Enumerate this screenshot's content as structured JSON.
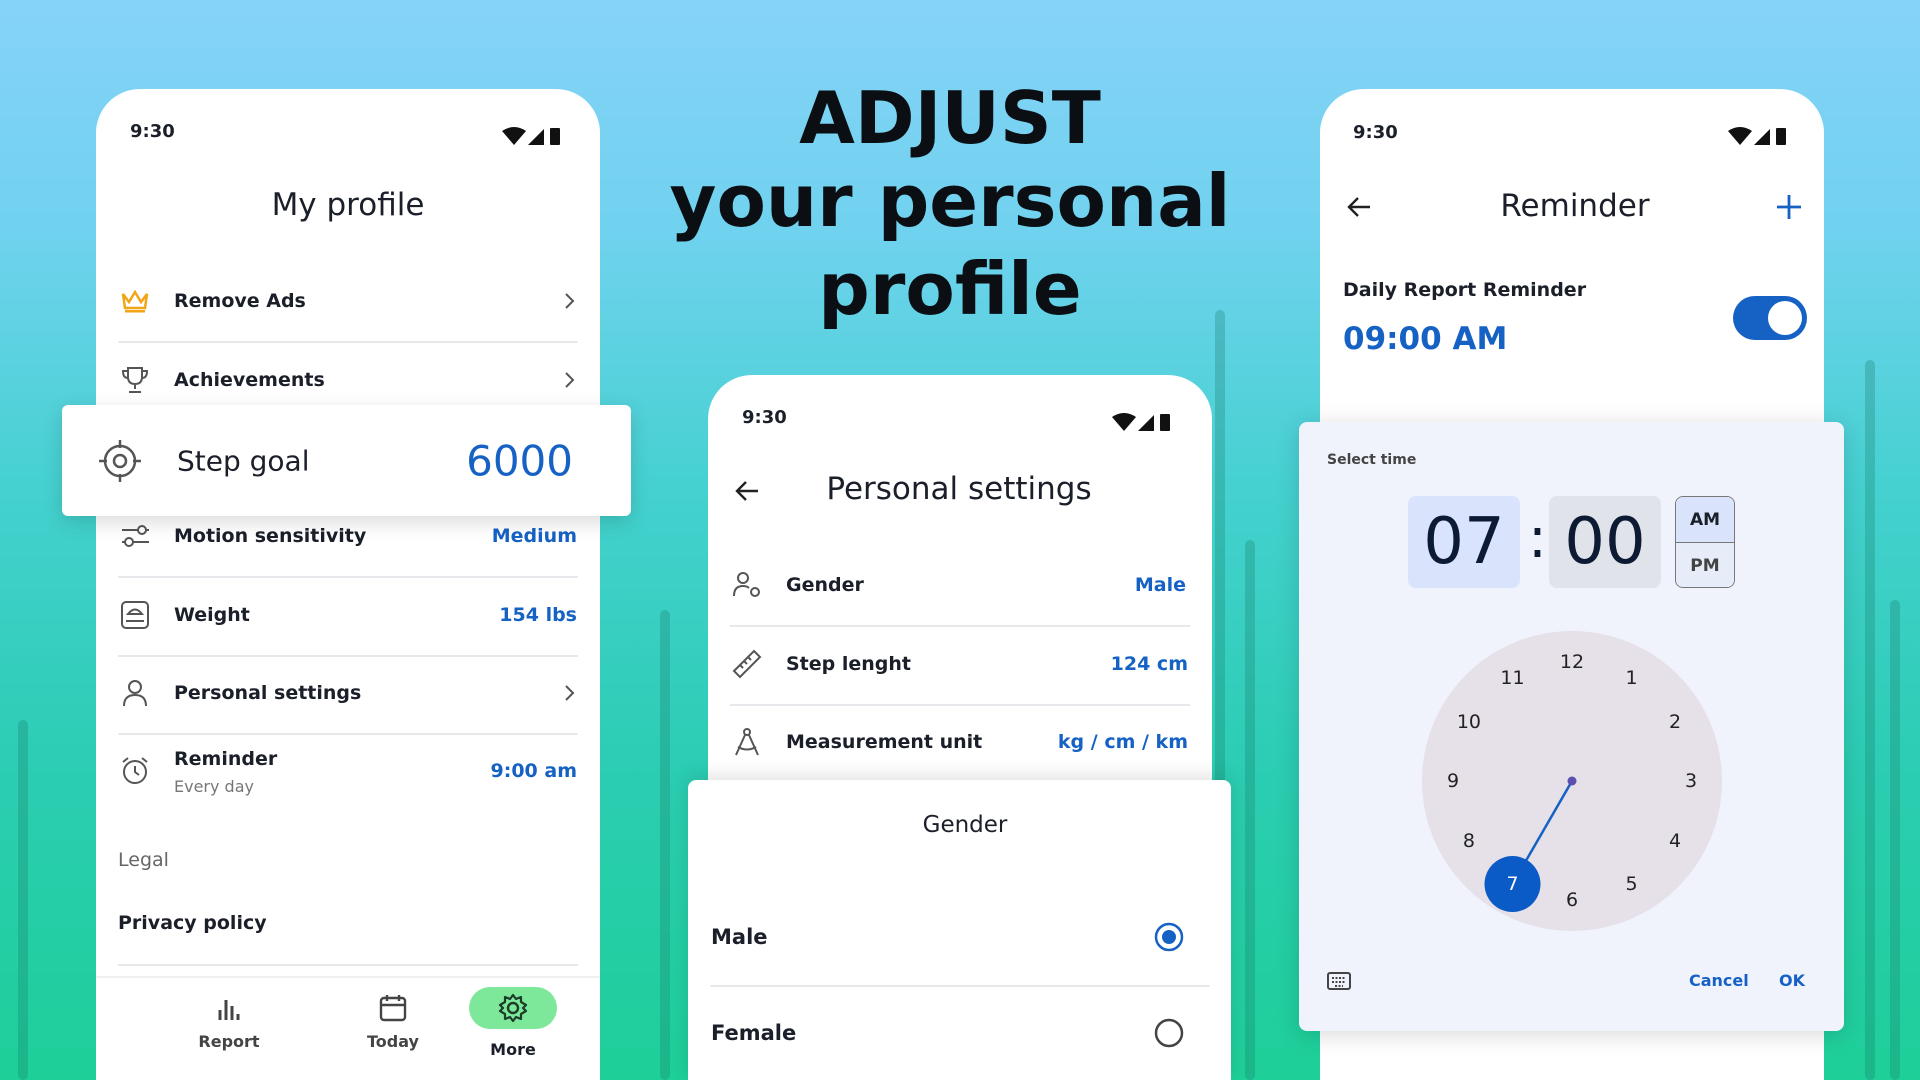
{
  "headline": {
    "line1": "ADJUST",
    "line2": "your personal",
    "line3": "profile"
  },
  "status_time": "9:30",
  "colors": {
    "accent": "#1662c4",
    "nav_active": "#7ee89a",
    "crown": "#f2a516"
  },
  "profile": {
    "title": "My profile",
    "items": [
      {
        "icon": "crown-icon",
        "label": "Remove Ads",
        "chevron": true
      },
      {
        "icon": "trophy-icon",
        "label": "Achievements",
        "chevron": true
      },
      {
        "icon": "target-icon",
        "label": "Step goal",
        "value": "6000"
      },
      {
        "icon": "sliders-icon",
        "label": "Motion sensitivity",
        "value": "Medium"
      },
      {
        "icon": "scale-icon",
        "label": "Weight",
        "value": "154 lbs"
      },
      {
        "icon": "person-icon",
        "label": "Personal settings",
        "chevron": true
      },
      {
        "icon": "alarm-icon",
        "label": "Reminder",
        "sublabel": "Every day",
        "value": "9:00 am"
      }
    ],
    "legal_header": "Legal",
    "privacy": "Privacy policy",
    "nav": [
      {
        "icon": "bar-chart-icon",
        "label": "Report"
      },
      {
        "icon": "calendar-icon",
        "label": "Today"
      },
      {
        "icon": "gear-icon",
        "label": "More",
        "active": true
      }
    ]
  },
  "personal": {
    "title": "Personal settings",
    "items": [
      {
        "icon": "gender-icon",
        "label": "Gender",
        "value": "Male"
      },
      {
        "icon": "ruler-icon",
        "label": "Step lenght",
        "value": "124 cm"
      },
      {
        "icon": "compass-icon",
        "label": "Measurement unit",
        "value": "kg / cm / km"
      }
    ],
    "sheet": {
      "title": "Gender",
      "options": [
        {
          "label": "Male",
          "selected": true
        },
        {
          "label": "Female",
          "selected": false
        }
      ]
    }
  },
  "reminder": {
    "title": "Reminder",
    "daily_label": "Daily Report Reminder",
    "daily_time": "09:00 AM",
    "enabled": true,
    "dialog": {
      "label": "Select time",
      "hour": "07",
      "minute": "00",
      "am": "AM",
      "pm": "PM",
      "selected_period": "AM",
      "numbers": [
        "12",
        "1",
        "2",
        "3",
        "4",
        "5",
        "6",
        "7",
        "8",
        "9",
        "10",
        "11"
      ],
      "selected_hour": "7",
      "cancel": "Cancel",
      "ok": "OK"
    }
  }
}
